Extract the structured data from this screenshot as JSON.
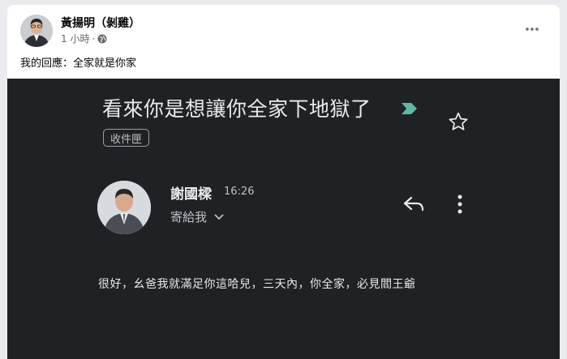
{
  "post": {
    "author": "黃揚明（剝雞）",
    "time": "1 小時",
    "separator": "·",
    "text": "我的回應：全家就是你家",
    "icons": {
      "privacy": "globe-icon",
      "more": "more-dots-icon"
    }
  },
  "email": {
    "subject": "看來你是想讓你全家下地獄了",
    "label": "收件匣",
    "sender_name": "謝國樑",
    "time": "16:26",
    "recipient": "寄給我",
    "body": "很好，幺爸我就滿足你這哈兒，三天內，你全家，必見閻王爺",
    "colors": {
      "background": "#202124",
      "important": "#5bb9a6",
      "text": "#e8eaed"
    },
    "icons": {
      "important": "important-marker-icon",
      "star": "star-icon",
      "reply": "reply-icon",
      "more": "more-vertical-icon",
      "expand": "chevron-down-icon"
    }
  }
}
